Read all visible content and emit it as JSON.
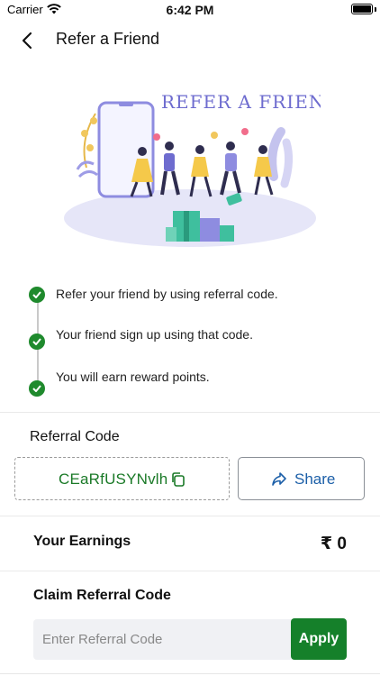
{
  "status_bar": {
    "carrier": "Carrier",
    "time": "6:42 PM"
  },
  "nav": {
    "title": "Refer a Friend"
  },
  "illustration": {
    "heading": "REFER A FRIEND"
  },
  "steps": [
    {
      "text": "Refer your friend by using referral code."
    },
    {
      "text": "Your friend sign up using that code."
    },
    {
      "text": "You will earn reward points."
    }
  ],
  "referral": {
    "label": "Referral Code",
    "code": "CEaRfUSYNvlh",
    "share_label": "Share"
  },
  "earnings": {
    "label": "Your Earnings",
    "value": "₹ 0"
  },
  "claim": {
    "label": "Claim Referral Code",
    "placeholder": "Enter Referral Code",
    "apply_label": "Apply"
  },
  "colors": {
    "accent_green": "#15802a",
    "code_green": "#1b7a28",
    "share_blue": "#1c5fa8",
    "illustration_purple": "#6e6ccf"
  }
}
